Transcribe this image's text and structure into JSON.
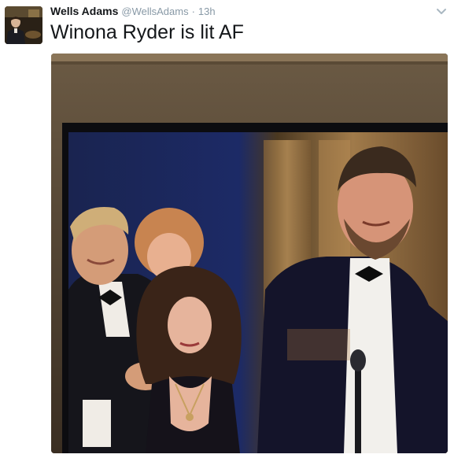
{
  "author": {
    "name": "Wells Adams",
    "handle": "@WellsAdams",
    "separator": "·",
    "time": "13h"
  },
  "tweet": {
    "text": "Winona Ryder is lit AF"
  },
  "icons": {
    "avatar": "profile-photo",
    "menu": "chevron-down-icon"
  },
  "colors": {
    "text_primary": "#14171a",
    "text_secondary": "#8899a6"
  }
}
